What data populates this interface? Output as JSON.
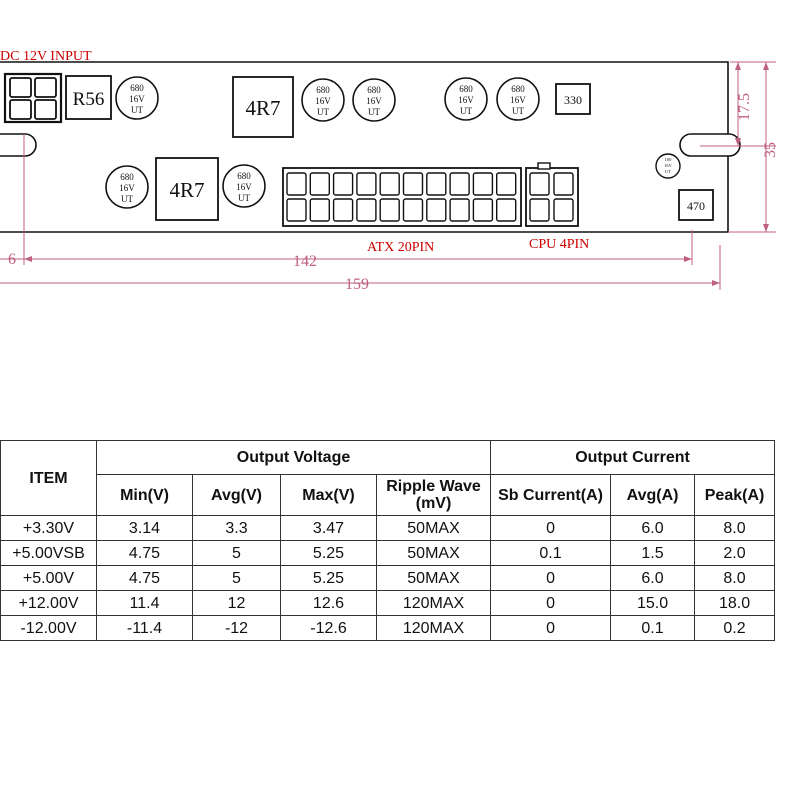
{
  "diagram": {
    "dc_input_label": "DC 12V INPUT",
    "atx_label": "ATX 20PIN",
    "cpu_label": "CPU 4PIN",
    "resistor_r56": "R56",
    "inductor_label": "4R7",
    "chip_330": "330",
    "chip_470": "470",
    "capacitor": {
      "line1": "680",
      "line2": "16V",
      "line3": "UT"
    },
    "small_capacitor": {
      "line1": "100",
      "line2": "16V",
      "line3": "UT"
    },
    "dimensions": {
      "d6": "6",
      "d142": "142",
      "d159": "159",
      "d17_5": "17.5",
      "d35": "35"
    },
    "colors": {
      "red_label": "#cc0000",
      "line": "#111111",
      "dim_line": "#c06080"
    }
  },
  "table": {
    "item_header": "ITEM",
    "output_voltage_header": "Output Voltage",
    "output_current_header": "Output Current",
    "sub_headers": [
      "Min(V)",
      "Avg(V)",
      "Max(V)",
      "Ripple Wave (mV)",
      "Sb Current(A)",
      "Avg(A)",
      "Peak(A)"
    ],
    "rows": [
      [
        "+3.30V",
        "3.14",
        "3.3",
        "3.47",
        "50MAX",
        "0",
        "6.0",
        "8.0"
      ],
      [
        "+5.00VSB",
        "4.75",
        "5",
        "5.25",
        "50MAX",
        "0.1",
        "1.5",
        "2.0"
      ],
      [
        "+5.00V",
        "4.75",
        "5",
        "5.25",
        "50MAX",
        "0",
        "6.0",
        "8.0"
      ],
      [
        "+12.00V",
        "11.4",
        "12",
        "12.6",
        "120MAX",
        "0",
        "15.0",
        "18.0"
      ],
      [
        "-12.00V",
        "-11.4",
        "-12",
        "-12.6",
        "120MAX",
        "0",
        "0.1",
        "0.2"
      ]
    ]
  }
}
